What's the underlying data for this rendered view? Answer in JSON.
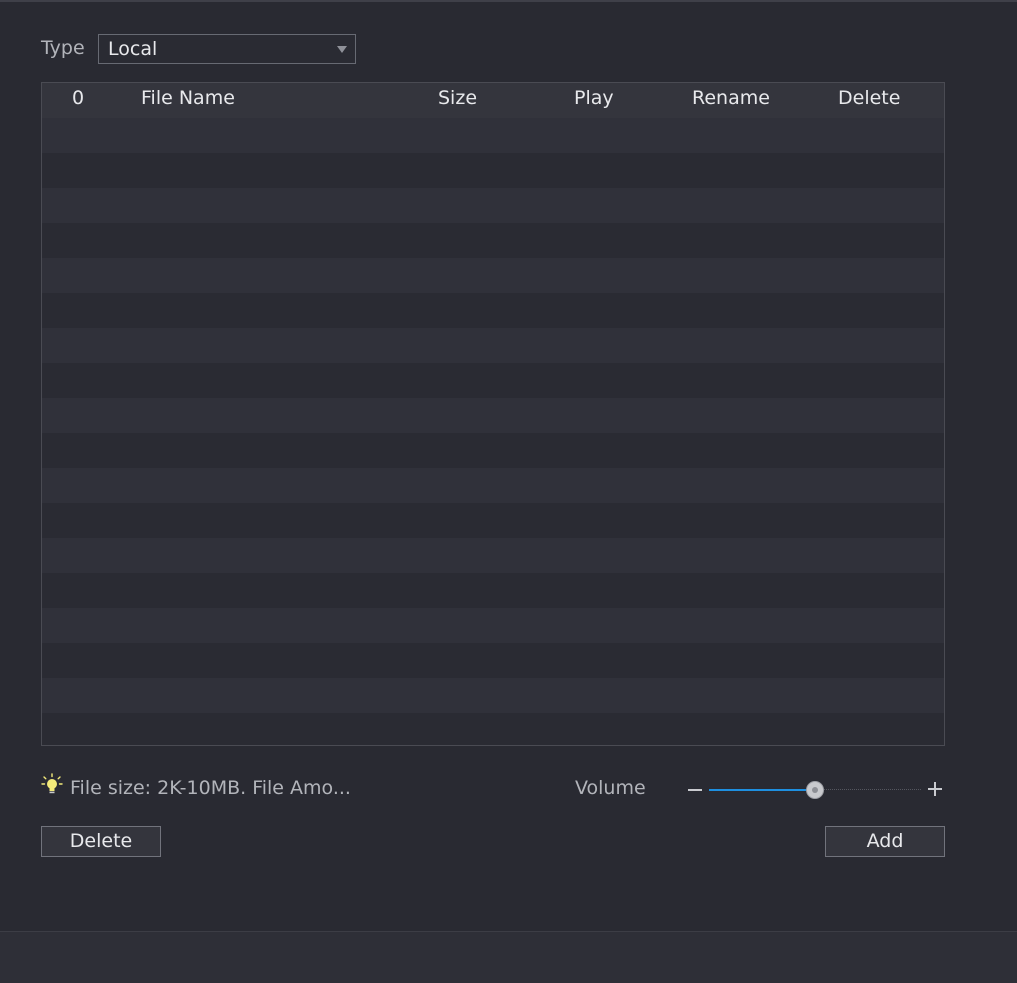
{
  "type_selector": {
    "label": "Type",
    "value": "Local"
  },
  "table": {
    "columns": [
      "0",
      "File Name",
      "Size",
      "Play",
      "Rename",
      "Delete"
    ],
    "rows": []
  },
  "tip": {
    "text": "File size: 2K-10MB. File Amo..."
  },
  "volume": {
    "label": "Volume",
    "level": 0.5
  },
  "buttons": {
    "delete": "Delete",
    "add": "Add"
  },
  "colors": {
    "accent": "#1e8fe0",
    "background": "#292a32"
  }
}
